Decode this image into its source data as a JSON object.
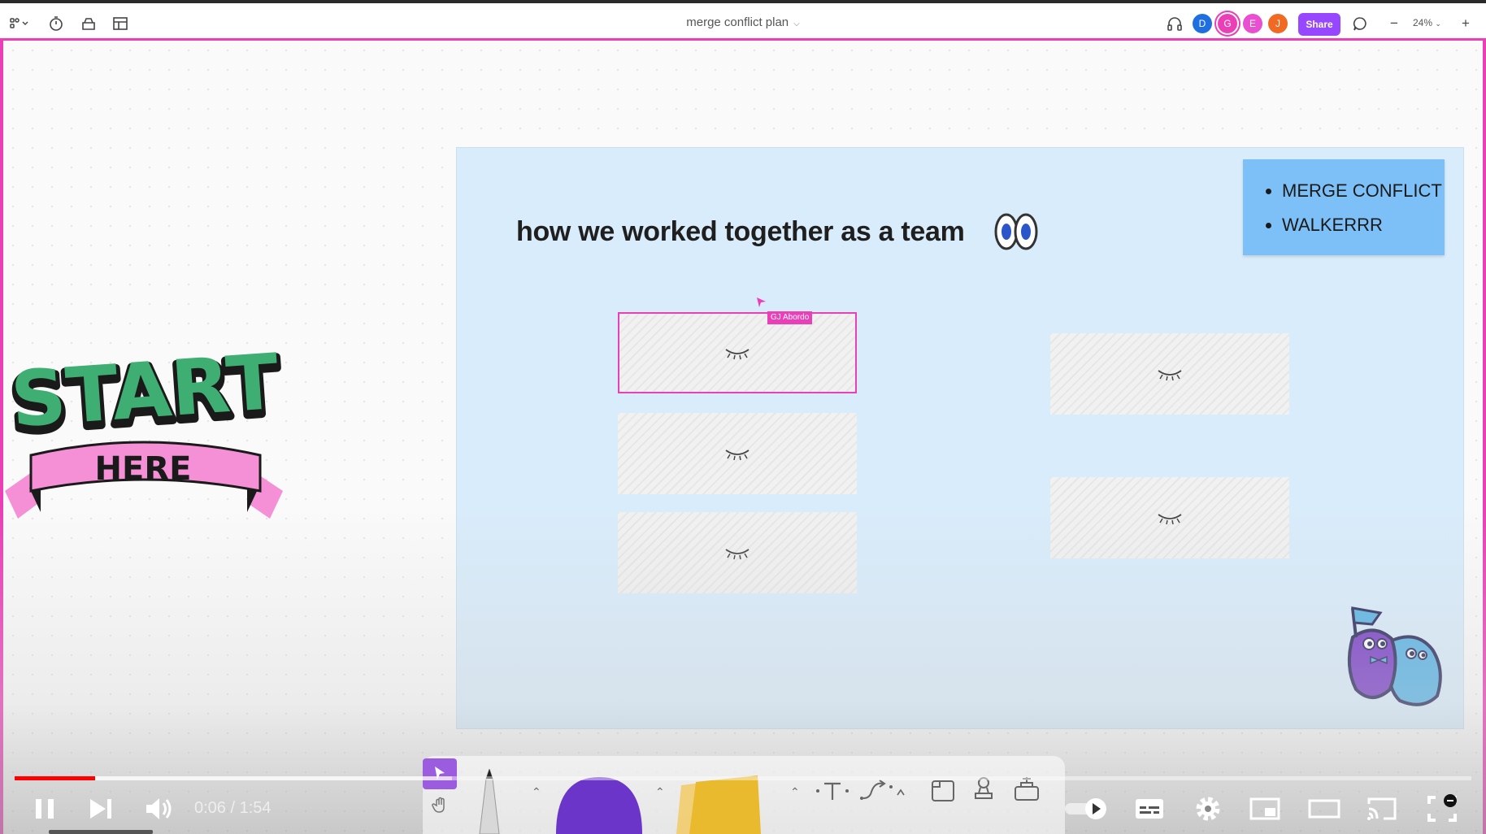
{
  "figjam": {
    "file_title": "merge conflict plan",
    "share_label": "Share",
    "zoom_label": "24%",
    "avatars": [
      {
        "letter": "D",
        "color": "#1f6fe0"
      },
      {
        "letter": "G",
        "color": "#ea3fb6"
      },
      {
        "letter": "E",
        "color": "#e84fd1"
      },
      {
        "letter": "J",
        "color": "#f06a23"
      }
    ]
  },
  "board": {
    "title": "how we worked together as a team",
    "note_items": [
      "MERGE CONFLICT",
      "WALKERRR"
    ],
    "collaborator_cursor_label": "GJ Abordo"
  },
  "sticker": {
    "start_text": "START",
    "here_text": "HERE"
  },
  "video": {
    "time_display": "0:06 / 1:54",
    "progress": 0.055,
    "buffered": 0.3
  },
  "colors": {
    "accent": "#ea3fb6",
    "share": "#9747ff",
    "board_bg": "#d9ecfb",
    "note_bg": "#7cc0f7",
    "progress": "#ff0000"
  }
}
